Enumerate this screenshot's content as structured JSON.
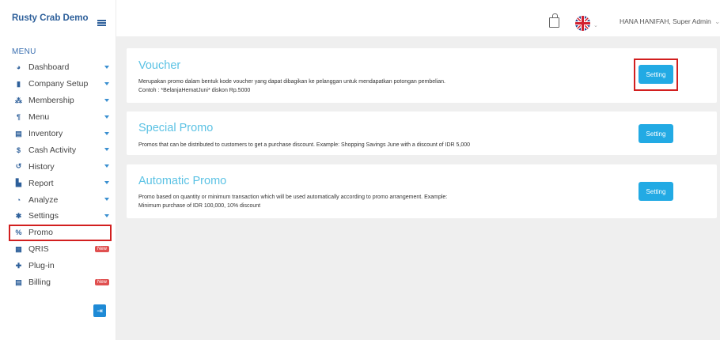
{
  "brand": "Rusty Crab Demo",
  "menu_header": "MENU",
  "sidebar": {
    "items": [
      {
        "label": "Dashboard",
        "icon": "palette-icon",
        "glyph": "◕",
        "caret": true
      },
      {
        "label": "Company Setup",
        "icon": "building-icon",
        "glyph": "▮",
        "caret": true
      },
      {
        "label": "Membership",
        "icon": "users-icon",
        "glyph": "⁂",
        "caret": true
      },
      {
        "label": "Menu",
        "icon": "utensils-icon",
        "glyph": "¶",
        "caret": true
      },
      {
        "label": "Inventory",
        "icon": "box-icon",
        "glyph": "▤",
        "caret": true
      },
      {
        "label": "Cash Activity",
        "icon": "dollar-icon",
        "glyph": "$",
        "caret": true
      },
      {
        "label": "History",
        "icon": "history-icon",
        "glyph": "↺",
        "caret": true
      },
      {
        "label": "Report",
        "icon": "file-icon",
        "glyph": "▙",
        "caret": true
      },
      {
        "label": "Analyze",
        "icon": "pie-chart-icon",
        "glyph": "◔",
        "caret": true
      },
      {
        "label": "Settings",
        "icon": "gear-icon",
        "glyph": "✱",
        "caret": true
      },
      {
        "label": "Promo",
        "icon": "percent-icon",
        "glyph": "%",
        "caret": false,
        "active": true
      },
      {
        "label": "QRIS",
        "icon": "qr-code-icon",
        "glyph": "▦",
        "caret": false,
        "badge": "New"
      },
      {
        "label": "Plug-in",
        "icon": "puzzle-icon",
        "glyph": "✚",
        "caret": false
      },
      {
        "label": "Billing",
        "icon": "receipt-icon",
        "glyph": "▤",
        "caret": false,
        "badge": "New"
      }
    ]
  },
  "topbar": {
    "user": "HANA HANIFAH, Super Admin",
    "user_caret": "⌄"
  },
  "cards": [
    {
      "title": "Voucher",
      "desc": "Merupakan promo dalam bentuk kode voucher yang dapat dibagikan ke pelanggan untuk mendapatkan potongan pembelian.\nContoh : *BelanjaHematJuni* diskon Rp.5000",
      "button": "Setting"
    },
    {
      "title": "Special Promo",
      "desc": "Promos that can be distributed to customers to get a purchase discount. Example: Shopping Savings June with a discount of IDR 5,000",
      "button": "Setting"
    },
    {
      "title": "Automatic Promo",
      "desc": "Promo based on quantity or minimum transaction which will be used automatically according to promo arrangement. Example:\nMinimum purchase of IDR 100,000, 10% discount",
      "button": "Setting"
    }
  ],
  "colors": {
    "brand": "#2d5f9a",
    "accent": "#22aae4",
    "title": "#5bc2e4",
    "highlight": "#d21f1f",
    "badge": "#e05050"
  }
}
